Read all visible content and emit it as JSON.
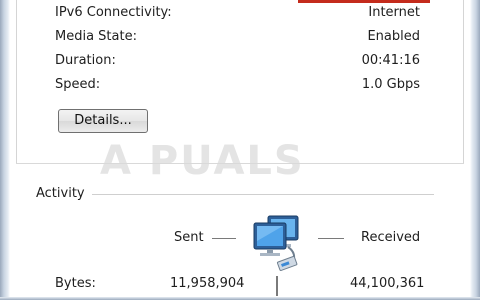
{
  "connection_details": {
    "rows": [
      {
        "label": "IPv6 Connectivity:",
        "value": "Internet"
      },
      {
        "label": "Media State:",
        "value": "Enabled"
      },
      {
        "label": "Duration:",
        "value": "00:41:16"
      },
      {
        "label": "Speed:",
        "value": "1.0 Gbps"
      }
    ],
    "details_button": "Details..."
  },
  "watermark": "A PUALS",
  "activity": {
    "title": "Activity",
    "sent_label": "Sent",
    "received_label": "Received",
    "bytes_label": "Bytes:",
    "bytes_sent": "11,958,904",
    "bytes_received": "44,100,361"
  },
  "icons": {
    "network": "network-computers-icon"
  },
  "colors": {
    "accent_red": "#c42b1c"
  }
}
